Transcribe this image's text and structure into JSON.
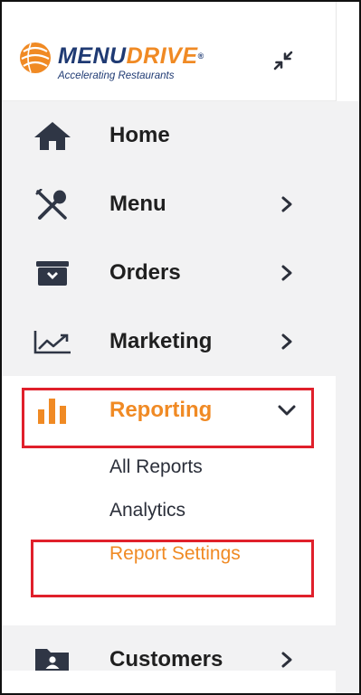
{
  "brand": {
    "name_part1": "MENU",
    "name_part2": "DRIVE",
    "trademark": "®",
    "tagline": "Accelerating Restaurants",
    "colors": {
      "navy": "#1f3a73",
      "orange": "#f08a24"
    }
  },
  "header": {
    "collapse_icon": "collapse-arrows-icon"
  },
  "nav": {
    "items": [
      {
        "label": "Home",
        "icon": "home-icon",
        "has_chevron": false
      },
      {
        "label": "Menu",
        "icon": "fork-spoon-icon",
        "has_chevron": true
      },
      {
        "label": "Orders",
        "icon": "inbox-tray-icon",
        "has_chevron": true
      },
      {
        "label": "Marketing",
        "icon": "trend-chart-icon",
        "has_chevron": true
      },
      {
        "label": "Reporting",
        "icon": "bar-chart-icon",
        "has_chevron": true,
        "expanded": true,
        "active": true
      },
      {
        "label": "Customers",
        "icon": "contact-folder-icon",
        "has_chevron": true
      }
    ],
    "reporting_submenu": [
      {
        "label": "All Reports"
      },
      {
        "label": "Analytics"
      },
      {
        "label": "Report Settings",
        "current": true
      }
    ]
  },
  "colors": {
    "accent": "#f08a24",
    "highlight": "#e0202b",
    "nav_bg": "#f2f2f3",
    "text": "#1f1f1f"
  }
}
